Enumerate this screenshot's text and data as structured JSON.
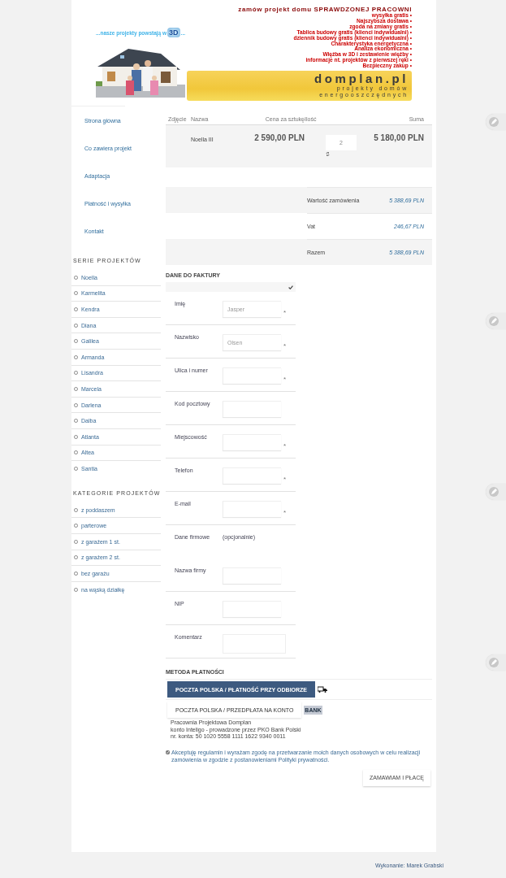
{
  "header": {
    "tagline": "zamów projekt domu SPRAWDZONEJ PRACOWNI",
    "benefits": [
      "wysyłka gratis •",
      "Najszybsza dostawa •",
      "zgoda na zmiany gratis •",
      "Tablica budowy gratis (klienci indywidualni) •",
      "dziennik budowy gratis (klienci indywidualni) •",
      "Charakterystyka energetyczna •",
      "Analiza ekonomiczna •",
      "Więźba w 3D i zestawienie więźby •",
      "informacje nt. projektów z pierwszej ręki •",
      "Bezpieczny zakup •"
    ],
    "slogan_start": "...nasze projekty powstają w",
    "slogan_badge": "3D",
    "slogan_end": "...",
    "logo": {
      "name": "domplan.pl",
      "line_1": "projekty domów",
      "line_2": "energooszczędnych"
    }
  },
  "nav": [
    "Strona główna",
    "Co zawiera projekt",
    "Adaptacja",
    "Płatność i wysyłka",
    "Kontakt"
  ],
  "series": {
    "title": "SERIE PROJEKTÓW",
    "items": [
      "Noella",
      "Karmelita",
      "Kendra",
      "Diana",
      "Galilea",
      "Armanda",
      "Lisandra",
      "Marcela",
      "Darlena",
      "Dalba",
      "Atlanta",
      "Altea",
      "Santia"
    ]
  },
  "categories": {
    "title": "KATEGORIE PROJEKTÓW",
    "items": [
      "z poddaszem",
      "parterowe",
      "z garażem 1 st.",
      "z garażem 2 st.",
      "bez garażu",
      "na wąską działkę"
    ]
  },
  "cart": {
    "columns": [
      "Zdjęcie",
      "Nazwa",
      "Cena za sztukę",
      "Ilość",
      "Suma"
    ],
    "rows": [
      {
        "name": "Noella III",
        "price": "2 590,00 PLN",
        "quantity": "2",
        "sum": "5 180,00 PLN"
      }
    ],
    "totals": [
      {
        "label": "Wartość zamówienia",
        "value": "5 388,69 PLN"
      },
      {
        "label": "Vat",
        "value": "246,67 PLN"
      },
      {
        "label": "Razem",
        "value": "5 388,69 PLN"
      }
    ]
  },
  "invoice": {
    "title": "DANE DO FAKTURY",
    "fields": [
      {
        "kind": "input",
        "label": "Imię",
        "placeholder": "Jasper",
        "mark": "*"
      },
      {
        "kind": "input",
        "label": "Nazwisko",
        "placeholder": "Olsen",
        "mark": "*"
      },
      {
        "kind": "input",
        "label": "Ulica i numer",
        "mark": "*"
      },
      {
        "kind": "input",
        "label": "Kod pocztowy"
      },
      {
        "kind": "input",
        "label": "Miejscowość",
        "mark": "*"
      },
      {
        "kind": "input",
        "label": "Telefon",
        "mark": "*"
      },
      {
        "kind": "input",
        "label": "E-mail",
        "mark": "*"
      },
      {
        "kind": "note",
        "label": "Dane firmowe",
        "note": "(opcjonalnie)"
      },
      {
        "kind": "input",
        "label": "Nazwa firmy"
      },
      {
        "kind": "input",
        "label": "NIP"
      },
      {
        "kind": "textarea",
        "label": "Komentarz"
      }
    ]
  },
  "payment": {
    "title": "METODA PŁATNOŚCI",
    "options": [
      {
        "label": "POCZTA POLSKA / PŁATNOŚĆ PRZY ODBIORZE",
        "selected": true,
        "kind": "truck"
      },
      {
        "label": "POCZTA POLSKA / PRZEDPŁATA NA KONTO",
        "selected": false,
        "kind": "bank",
        "badge": "BANK"
      }
    ],
    "bank_details": [
      "Pracownia Projektowa Domplan",
      "konto Inteligo - prowadzone przez PKO Bank Polski",
      "nr. konta: 50 1020 5558 1111 1622 9340 0011"
    ]
  },
  "consent": {
    "checked": true,
    "text": "Akceptuję regulamin i wyrażam zgodę na przetwarzanie moich danych osobowych w celu realizacji zamówienia w zgodzie z postanowieniami Polityki prywatności."
  },
  "submit": "ZAMAWIAM I PŁACĘ",
  "footer": "Wykonanie: Marek Grabski"
}
